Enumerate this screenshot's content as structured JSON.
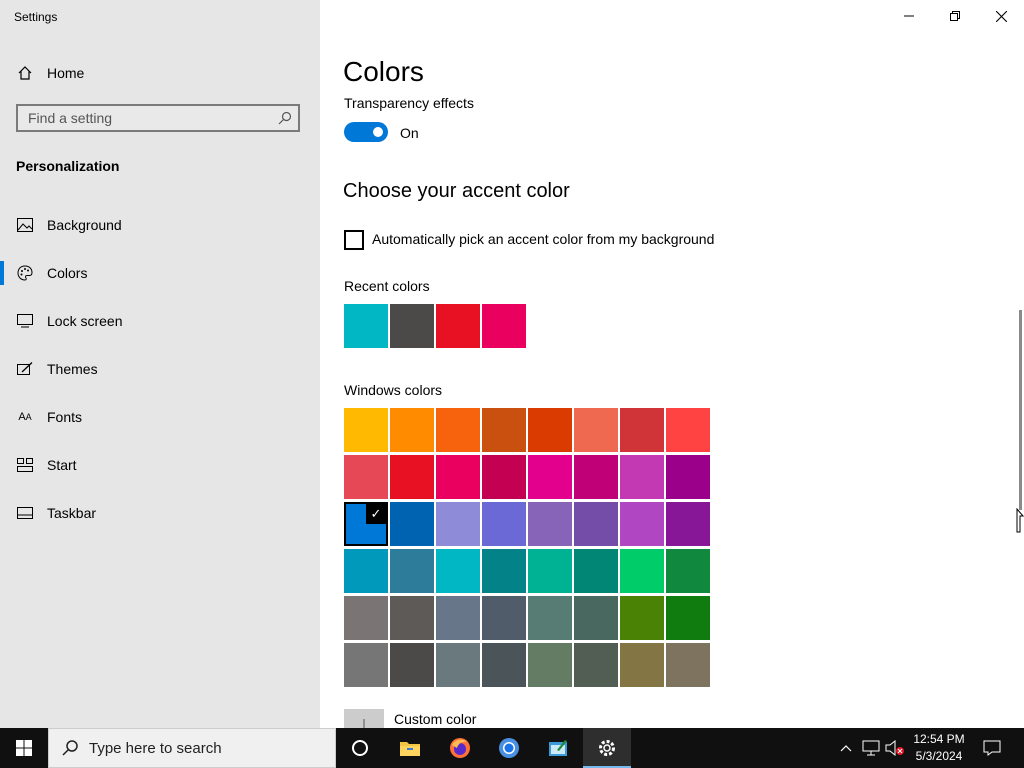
{
  "window": {
    "title": "Settings"
  },
  "sidebar": {
    "home_label": "Home",
    "search_placeholder": "Find a setting",
    "section_title": "Personalization",
    "items": [
      {
        "label": "Background",
        "icon": "image-icon"
      },
      {
        "label": "Colors",
        "icon": "palette-icon",
        "active": true
      },
      {
        "label": "Lock screen",
        "icon": "lock-screen-icon"
      },
      {
        "label": "Themes",
        "icon": "brush-icon"
      },
      {
        "label": "Fonts",
        "icon": "fonts-icon"
      },
      {
        "label": "Start",
        "icon": "start-icon"
      },
      {
        "label": "Taskbar",
        "icon": "taskbar-icon"
      }
    ]
  },
  "main": {
    "title": "Colors",
    "transparency": {
      "label": "Transparency effects",
      "state_label": "On",
      "on": true
    },
    "accent_heading": "Choose your accent color",
    "auto_pick_label": "Automatically pick an accent color from my background",
    "auto_pick_checked": false,
    "recent_colors_label": "Recent colors",
    "recent_colors": [
      "#00b7c3",
      "#4c4a48",
      "#e81123",
      "#ea005e"
    ],
    "windows_colors_label": "Windows colors",
    "windows_colors": [
      [
        "#ffb900",
        "#ff8c00",
        "#f7630c",
        "#ca5010",
        "#da3b01",
        "#ef6950",
        "#d13438",
        "#ff4343"
      ],
      [
        "#e74856",
        "#e81123",
        "#ea005e",
        "#c30052",
        "#e3008c",
        "#bf0077",
        "#c239b3",
        "#9a0089"
      ],
      [
        "#0078d7",
        "#0063b1",
        "#8e8cd8",
        "#6b69d6",
        "#8764b8",
        "#744da9",
        "#b146c2",
        "#881798"
      ],
      [
        "#0099bc",
        "#2d7d9a",
        "#00b7c3",
        "#038387",
        "#00b294",
        "#018574",
        "#00cc6a",
        "#10893e"
      ],
      [
        "#7a7574",
        "#5d5a58",
        "#68768a",
        "#515c6b",
        "#567c73",
        "#486860",
        "#498205",
        "#107c10"
      ],
      [
        "#767676",
        "#4c4a48",
        "#69797e",
        "#4a5459",
        "#647c64",
        "#525e54",
        "#847545",
        "#7e735f"
      ]
    ],
    "selected_color": "#0078d7",
    "custom_color_label": "Custom color"
  },
  "taskbar": {
    "search_placeholder": "Type here to search",
    "apps": [
      "cortana-icon",
      "file-explorer-icon",
      "firefox-icon",
      "chrome-icon",
      "notepad-icon",
      "settings-icon"
    ],
    "time": "12:54 PM",
    "date": "5/3/2024"
  }
}
